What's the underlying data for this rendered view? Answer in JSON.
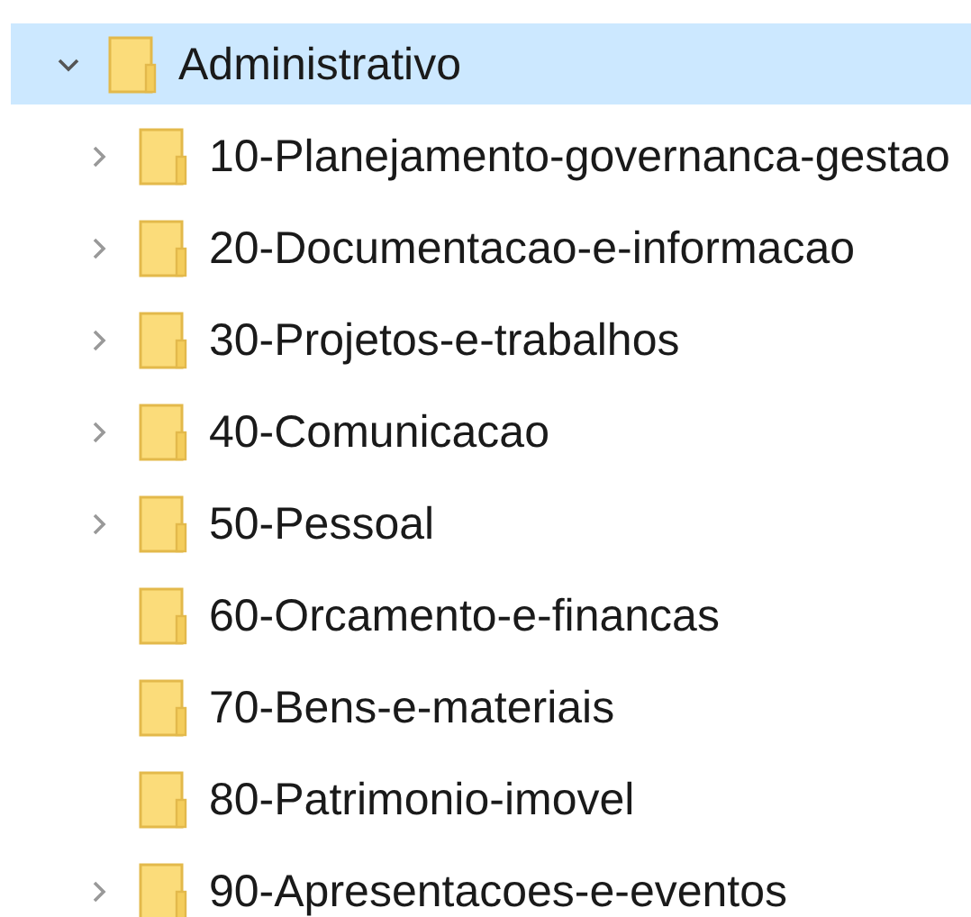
{
  "tree": [
    {
      "name": "Administrativo",
      "selected": true,
      "expanded": true,
      "has_children": true,
      "children": [
        {
          "name": "10-Planejamento-governanca-gestao",
          "selected": false,
          "expanded": false,
          "has_children": true
        },
        {
          "name": "20-Documentacao-e-informacao",
          "selected": false,
          "expanded": false,
          "has_children": true
        },
        {
          "name": "30-Projetos-e-trabalhos",
          "selected": false,
          "expanded": false,
          "has_children": true
        },
        {
          "name": "40-Comunicacao",
          "selected": false,
          "expanded": false,
          "has_children": true
        },
        {
          "name": "50-Pessoal",
          "selected": false,
          "expanded": false,
          "has_children": true
        },
        {
          "name": "60-Orcamento-e-financas",
          "selected": false,
          "expanded": false,
          "has_children": false
        },
        {
          "name": "70-Bens-e-materiais",
          "selected": false,
          "expanded": false,
          "has_children": false
        },
        {
          "name": "80-Patrimonio-imovel",
          "selected": false,
          "expanded": false,
          "has_children": false
        },
        {
          "name": "90-Apresentacoes-e-eventos",
          "selected": false,
          "expanded": false,
          "has_children": true
        }
      ]
    }
  ]
}
